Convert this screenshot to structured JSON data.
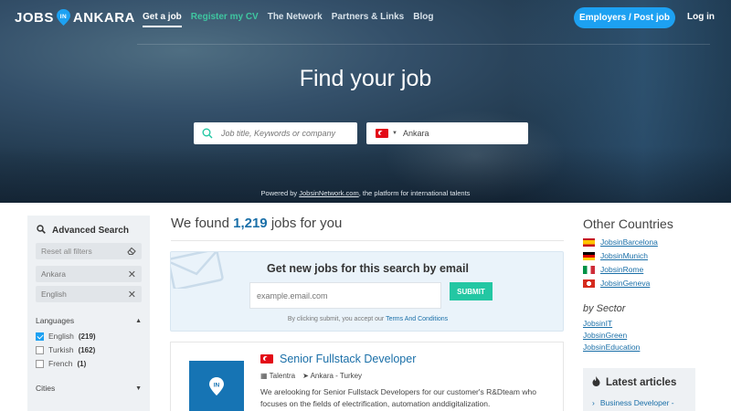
{
  "nav": {
    "logo_left": "JOBS",
    "logo_pin": "IN",
    "logo_right": "ANKARA",
    "links": [
      "Get a job",
      "Register my CV",
      "The Network",
      "Partners & Links",
      "Blog"
    ],
    "employers_button": "Employers / Post job",
    "login": "Log in"
  },
  "hero": {
    "title": "Find your job",
    "search_placeholder": "Job title, Keywords or company",
    "location_value": "Ankara",
    "powered_prefix": "Powered by",
    "powered_link": "JobsinNetwork.com",
    "powered_suffix": ", the platform for international talents"
  },
  "sidebar": {
    "title": "Advanced Search",
    "reset": "Reset all filters",
    "chips": [
      "Ankara",
      "English"
    ],
    "languages_label": "Languages",
    "languages": [
      {
        "label": "English",
        "count": "(219)",
        "checked": true
      },
      {
        "label": "Turkish",
        "count": "(162)",
        "checked": false
      },
      {
        "label": "French",
        "count": "(1)",
        "checked": false
      }
    ],
    "cities_label": "Cities"
  },
  "results": {
    "prefix": "We found",
    "count": "1,219",
    "suffix": "jobs for you"
  },
  "alert": {
    "title": "Get new jobs for this search by email",
    "email_placeholder": "example.email.com",
    "submit": "SUBMIT",
    "terms_prefix": "By clicking submit, you accept our",
    "terms_link": "Terms And Conditions"
  },
  "job": {
    "logo_text": "IN",
    "title": "Senior Fullstack Developer",
    "company": "Talentra",
    "location": "Ankara - Turkey",
    "description": "We arelooking for Senior Fullstack Developers for our customer's R&Dteam who focuses on the fields of electrification, automation anddigitalization."
  },
  "right": {
    "other_title": "Other Countries",
    "countries": [
      {
        "label": "JobsinBarcelona",
        "flag": "es"
      },
      {
        "label": "JobsinMunich",
        "flag": "de"
      },
      {
        "label": "JobsinRome",
        "flag": "it"
      },
      {
        "label": "JobsinGeneva",
        "flag": "ch"
      }
    ],
    "sector_title": "by Sector",
    "sectors": [
      "JobsinIT",
      "JobsinGreen",
      "JobsinEducation"
    ],
    "latest_title": "Latest articles",
    "latest_item": "Business Developer -"
  },
  "colors": {
    "accent_blue": "#1da1f2",
    "link_blue": "#1a6fa8",
    "submit_green": "#23c7a3",
    "nav_green": "#3fc6a0"
  }
}
